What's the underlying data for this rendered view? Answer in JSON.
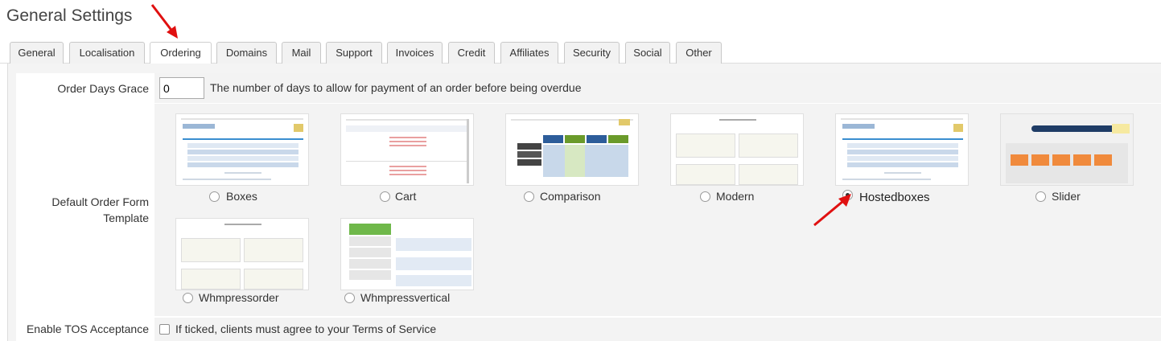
{
  "page_title": "General Settings",
  "tabs": [
    {
      "label": "General",
      "active": false
    },
    {
      "label": "Localisation",
      "active": false
    },
    {
      "label": "Ordering",
      "active": true
    },
    {
      "label": "Domains",
      "active": false
    },
    {
      "label": "Mail",
      "active": false
    },
    {
      "label": "Support",
      "active": false
    },
    {
      "label": "Invoices",
      "active": false
    },
    {
      "label": "Credit",
      "active": false
    },
    {
      "label": "Affiliates",
      "active": false
    },
    {
      "label": "Security",
      "active": false
    },
    {
      "label": "Social",
      "active": false
    },
    {
      "label": "Other",
      "active": false
    }
  ],
  "order_days_grace": {
    "label": "Order Days Grace",
    "value": "0",
    "hint": "The number of days to allow for payment of an order before being overdue"
  },
  "order_form_template": {
    "label": "Default Order Form Template",
    "selected": "Hostedboxes",
    "templates": [
      {
        "name": "Boxes"
      },
      {
        "name": "Cart"
      },
      {
        "name": "Comparison"
      },
      {
        "name": "Modern"
      },
      {
        "name": "Hostedboxes"
      },
      {
        "name": "Slider"
      },
      {
        "name": "Whmpressorder"
      },
      {
        "name": "Whmpressvertical"
      }
    ]
  },
  "tos": {
    "label": "Enable TOS Acceptance",
    "hint": "If ticked, clients must agree to your Terms of Service",
    "checked": false
  },
  "annotation_color": "#e01010"
}
